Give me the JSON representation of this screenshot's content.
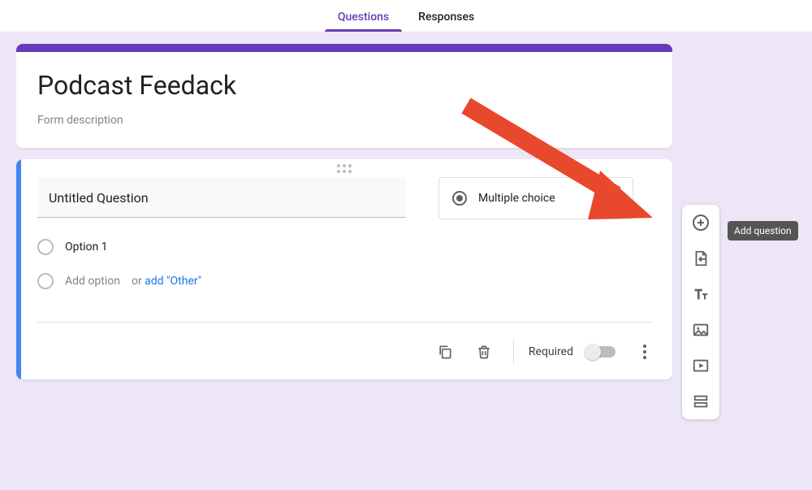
{
  "tabs": {
    "questions": "Questions",
    "responses": "Responses"
  },
  "header": {
    "title": "Podcast Feedack",
    "description": "Form description"
  },
  "question": {
    "title": "Untitled Question",
    "type_label": "Multiple choice",
    "option1": "Option 1",
    "add_option": "Add option",
    "or_text": " or ",
    "add_other": "add \"Other\""
  },
  "footer": {
    "required": "Required"
  },
  "tooltip": {
    "add_question": "Add question"
  }
}
